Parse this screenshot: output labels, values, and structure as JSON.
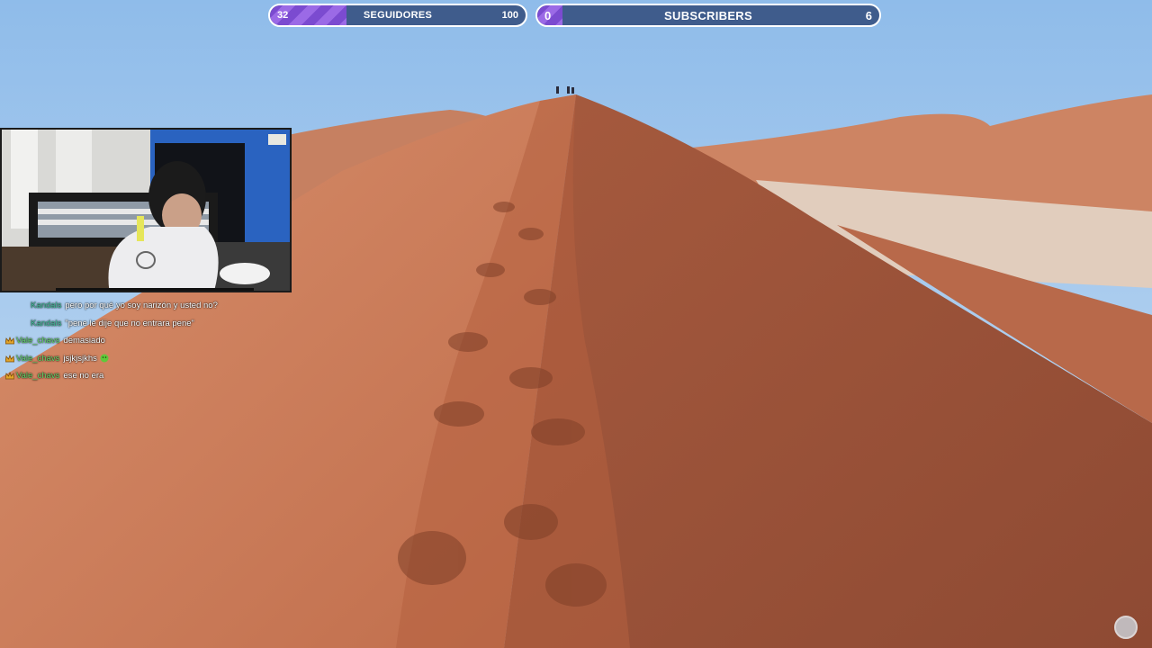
{
  "goals": {
    "followers": {
      "label": "SEGUIDORES",
      "current": "32",
      "target": "100",
      "progress": 0.32
    },
    "subscribers": {
      "label": "SUBSCRIBERS",
      "current": "0",
      "target": "6",
      "progress": 0.0
    }
  },
  "chat": {
    "messages": [
      {
        "user": "Kandals",
        "text": "pero por qué yo soy narizón y usted no?",
        "badge": ""
      },
      {
        "user": "Kandals",
        "text": "\"pene le dije que no entrara pene\"",
        "badge": ""
      },
      {
        "user": "Vale_chavs",
        "text": "demasiado",
        "badge": "crown-badge"
      },
      {
        "user": "Vale_chavs",
        "text": "jsjkjsjkhs",
        "badge": "crown-badge",
        "emote": "green-emote-icon"
      },
      {
        "user": "Vale_chavs",
        "text": "ese no era",
        "badge": "crown-badge"
      }
    ]
  },
  "colors": {
    "goal_fill": "#7b4bd0",
    "goal_bg": "#3f5c8c",
    "user_teal": "#46c3a0",
    "user_green": "#66d96b"
  }
}
